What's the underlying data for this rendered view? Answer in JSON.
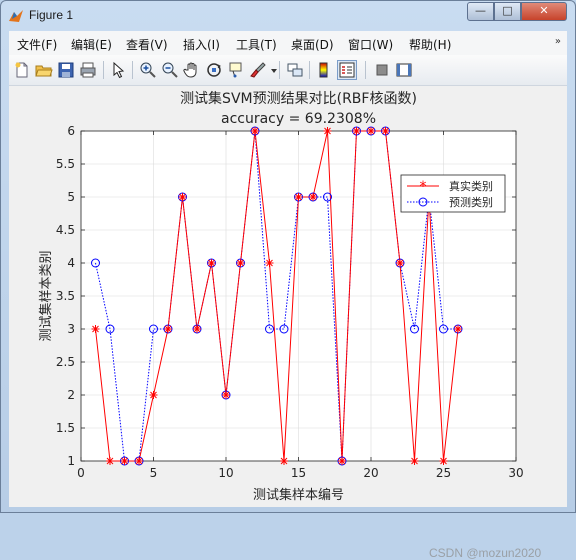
{
  "window": {
    "title": "Figure 1"
  },
  "controls": {
    "minimize": "—",
    "maximize": "□",
    "close": "✕"
  },
  "menu": [
    "文件(F)",
    "编辑(E)",
    "查看(V)",
    "插入(I)",
    "工具(T)",
    "桌面(D)",
    "窗口(W)",
    "帮助(H)"
  ],
  "menu_overflow": "»",
  "toolbar": [
    "new-figure-icon",
    "open-folder-icon",
    "save-icon",
    "print-icon",
    "pointer-icon",
    "zoom-in-icon",
    "zoom-out-icon",
    "pan-hand-icon",
    "rotate-3d-icon",
    "data-cursor-icon",
    "brush-icon",
    "link-icon",
    "colorbar-icon",
    "legend-icon",
    "hide-plot-tools-icon",
    "show-plot-tools-icon"
  ],
  "chart_data": {
    "type": "line",
    "title": "测试集SVM预测结果对比(RBF核函数)",
    "subtitle": "accuracy = 69.2308%",
    "xlabel": "测试集样本编号",
    "ylabel": "测试集样本类别",
    "xlim": [
      0,
      30
    ],
    "ylim": [
      1,
      6
    ],
    "xticks": [
      0,
      5,
      10,
      15,
      20,
      25,
      30
    ],
    "yticks": [
      1,
      1.5,
      2,
      2.5,
      3,
      3.5,
      4,
      4.5,
      5,
      5.5,
      6
    ],
    "grid": true,
    "legend_position": "top-right",
    "x": [
      1,
      2,
      3,
      4,
      5,
      6,
      7,
      8,
      9,
      10,
      11,
      12,
      13,
      14,
      15,
      16,
      17,
      18,
      19,
      20,
      21,
      22,
      23,
      24,
      25,
      26
    ],
    "series": [
      {
        "name": "真实类别",
        "color": "#ff0000",
        "style": "solid",
        "marker": "asterisk",
        "values": [
          3,
          1,
          1,
          1,
          2,
          3,
          5,
          3,
          4,
          2,
          4,
          6,
          4,
          1,
          5,
          5,
          6,
          1,
          6,
          6,
          6,
          4,
          1,
          5,
          1,
          3
        ]
      },
      {
        "name": "预测类别",
        "color": "#0000ff",
        "style": "dotted",
        "marker": "circle",
        "values": [
          4,
          3,
          1,
          1,
          3,
          3,
          5,
          3,
          4,
          2,
          4,
          6,
          3,
          3,
          5,
          5,
          5,
          1,
          6,
          6,
          6,
          4,
          3,
          5,
          3,
          3
        ]
      }
    ]
  },
  "watermark": "CSDN @mozun2020"
}
